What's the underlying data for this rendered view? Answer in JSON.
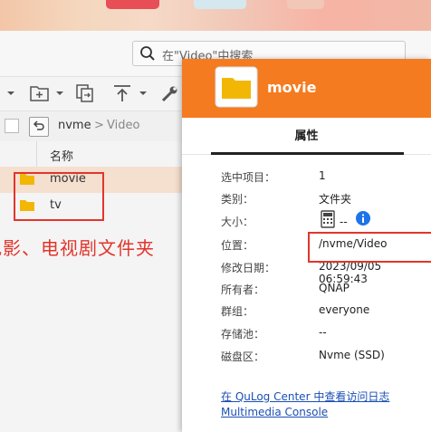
{
  "search": {
    "placeholder": "在\"Video\"中搜索"
  },
  "breadcrumb": {
    "root": "nvme",
    "separator": ">",
    "current": "Video"
  },
  "list": {
    "column_name": "名称",
    "rows": [
      {
        "name": "movie",
        "selected": true
      },
      {
        "name": "tv",
        "selected": false
      }
    ]
  },
  "annotation": "电影、电视剧文件夹",
  "dialog": {
    "title": "movie",
    "tab": "属性",
    "properties": [
      {
        "label": "选中项目：",
        "value": "1"
      },
      {
        "label": "类别：",
        "value": "文件夹"
      },
      {
        "label": "大小：",
        "value": "--"
      },
      {
        "label": "位置：",
        "value": "/nvme/Video"
      },
      {
        "label": "修改日期：",
        "value": "2023/09/05 06:59:43"
      },
      {
        "label": "所有者：",
        "value": "QNAP"
      },
      {
        "label": "群组：",
        "value": "everyone"
      },
      {
        "label": "存储池：",
        "value": "--"
      },
      {
        "label": "磁盘区：",
        "value": "Nvme (SSD)"
      }
    ],
    "links": [
      "在 QuLog Center 中查看访问日志",
      "Multimedia Console"
    ]
  },
  "colors": {
    "accent": "#f47b20",
    "highlight_row": "#f5dfcf",
    "annotation": "#e2352b",
    "link": "#1a4fb5"
  }
}
